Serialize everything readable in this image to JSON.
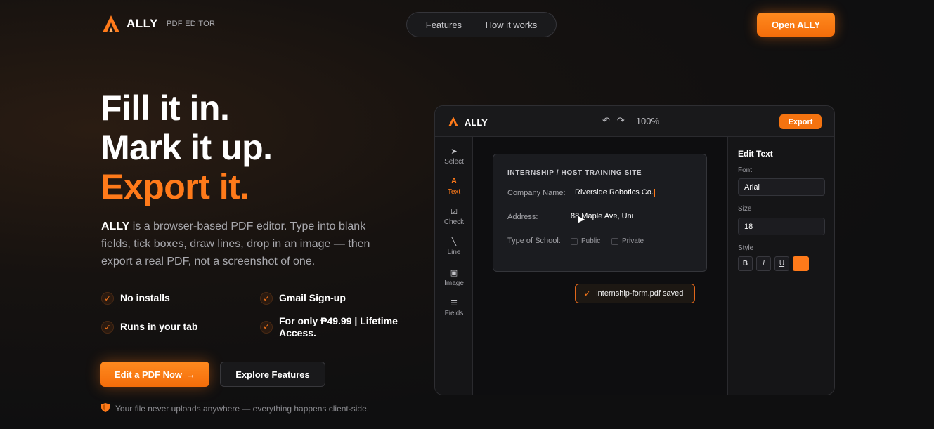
{
  "nav": {
    "brand_name": "ALLY",
    "brand_sub": "PDF EDITOR",
    "links": [
      "Features",
      "How it works"
    ],
    "open_button": "Open ALLY"
  },
  "hero": {
    "line1": "Fill it in.",
    "line2": "Mark it up.",
    "line3": "Export it.",
    "desc_brand": "ALLY",
    "desc_rest": " is a browser-based PDF editor. Type into blank fields, tick boxes, draw lines, drop in an image — then export a real PDF, not a screenshot of one.",
    "features": [
      "No installs",
      "Gmail Sign-up",
      "Runs in your tab",
      "For only ₱49.99 | Lifetime Access."
    ],
    "cta_primary": "Edit a PDF Now",
    "cta_secondary": "Explore Features",
    "note": "Your file never uploads anywhere — everything happens client-side."
  },
  "editor": {
    "brand": "ALLY",
    "zoom": "100%",
    "export": "Export",
    "tools": [
      "Select",
      "Text",
      "Check",
      "Line",
      "Image",
      "Fields"
    ],
    "active_tool": "Text",
    "doc": {
      "title": "INTERNSHIP / HOST TRAINING SITE",
      "company_label": "Company Name:",
      "company_value": "Riverside Robotics Co.",
      "address_label": "Address:",
      "address_value": "88 Maple Ave, Uni",
      "school_label": "Type of School:",
      "options": [
        "Public",
        "Private"
      ]
    },
    "toast": "internship-form.pdf saved",
    "panel": {
      "title": "Edit Text",
      "font_label": "Font",
      "font_value": "Arial",
      "size_label": "Size",
      "size_value": "18",
      "style_label": "Style",
      "style_buttons": [
        "B",
        "I",
        "U"
      ]
    }
  },
  "colors": {
    "accent": "#ff7a1a",
    "background": "#0f0f10"
  }
}
